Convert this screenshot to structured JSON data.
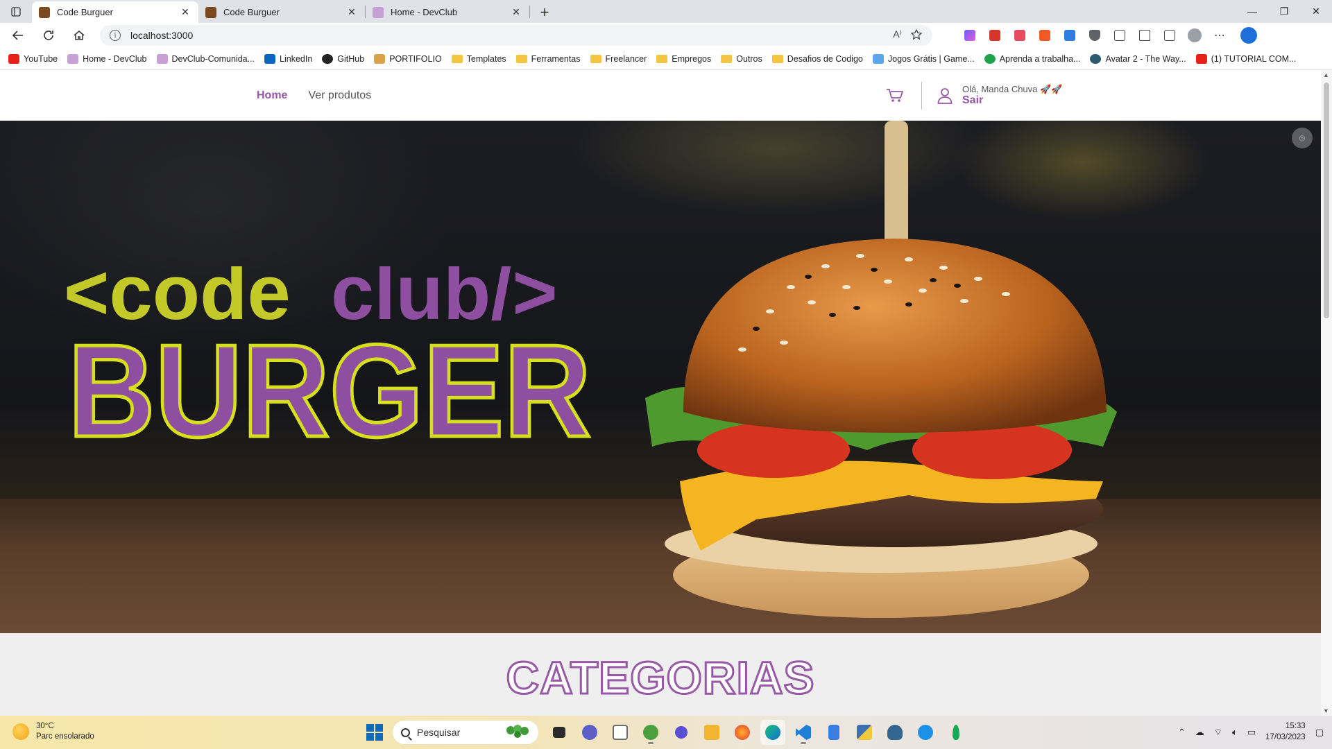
{
  "browser": {
    "tabs": [
      {
        "title": "Code Burguer",
        "active": true,
        "favicon_color": "#7a4a1e"
      },
      {
        "title": "Code Burguer",
        "active": false,
        "favicon_color": "#7a4a1e"
      },
      {
        "title": "Home - DevClub",
        "active": false,
        "favicon_color": "#c7a0d6"
      }
    ],
    "new_tab_icon": "+",
    "window_controls": {
      "minimize": "—",
      "restore": "❐",
      "close": "✕"
    },
    "url": "localhost:3000",
    "read_aloud_icon": "A⁾",
    "bookmarks": [
      {
        "label": "YouTube",
        "icon": "youtube-icon",
        "color": "#e62117"
      },
      {
        "label": "Home - DevClub",
        "icon": "devclub-icon",
        "color": "#c7a0d6"
      },
      {
        "label": "DevClub-Comunida...",
        "icon": "devclub-icon",
        "color": "#c7a0d6"
      },
      {
        "label": "LinkedIn",
        "icon": "linkedin-icon",
        "color": "#0a66c2"
      },
      {
        "label": "GitHub",
        "icon": "github-icon",
        "color": "#222222"
      },
      {
        "label": "PORTIFOLIO",
        "icon": "portfolio-icon",
        "color": "#d9a24b"
      },
      {
        "label": "Templates",
        "icon": "folder-icon",
        "color": "#f4c542"
      },
      {
        "label": "Ferramentas",
        "icon": "folder-icon",
        "color": "#f4c542"
      },
      {
        "label": "Freelancer",
        "icon": "folder-icon",
        "color": "#f4c542"
      },
      {
        "label": "Empregos",
        "icon": "folder-icon",
        "color": "#f4c542"
      },
      {
        "label": "Outros",
        "icon": "folder-icon",
        "color": "#f4c542"
      },
      {
        "label": "Desafios de Codigo",
        "icon": "folder-icon",
        "color": "#f4c542"
      },
      {
        "label": "Jogos Grátis | Game...",
        "icon": "games-icon",
        "color": "#5aa6e8"
      },
      {
        "label": "Aprenda a trabalha...",
        "icon": "hotmart-icon",
        "color": "#1fa34a"
      },
      {
        "label": "Avatar 2 - The Way...",
        "icon": "avatar-icon",
        "color": "#2a5b6e"
      },
      {
        "label": "(1) TUTORIAL COM...",
        "icon": "youtube-icon",
        "color": "#e62117"
      }
    ]
  },
  "site": {
    "nav": {
      "home": "Home",
      "products": "Ver produtos"
    },
    "greeting": "Olá, Manda Chuva 🚀🚀",
    "logout": "Sair",
    "brand_color": "#9758a6",
    "logo": {
      "code": "<code",
      "club": "club/>",
      "burger": "BURGER",
      "lime": "#c4c92a",
      "purple": "#8f4fa0"
    },
    "categories_title": "CATEGORIAS"
  },
  "taskbar": {
    "weather_temp": "30°C",
    "weather_desc": "Parc ensolarado",
    "search_placeholder": "Pesquisar",
    "time": "15:33",
    "date": "17/03/2023",
    "apps": [
      {
        "name": "task-view-icon",
        "color": "#2b2b2b",
        "open": false
      },
      {
        "name": "teams-chat-icon",
        "color": "#5b5fc7",
        "open": false
      },
      {
        "name": "notepad-icon",
        "color": "#6e6e6e",
        "open": false
      },
      {
        "name": "utorrent-icon",
        "color": "#4aa03f",
        "open": true
      },
      {
        "name": "app-moon-icon",
        "color": "#5b4fd6",
        "open": false
      },
      {
        "name": "file-explorer-icon",
        "color": "#f2b632",
        "open": false
      },
      {
        "name": "firefox-icon",
        "color": "#f06a2a",
        "open": false
      },
      {
        "name": "edge-icon",
        "color": "#12a37f",
        "open": true,
        "focus": true
      },
      {
        "name": "vscode-icon",
        "color": "#1f7fd6",
        "open": true
      },
      {
        "name": "notes-icon",
        "color": "#3b7de0",
        "open": false
      },
      {
        "name": "python-icon",
        "color": "#3e6fb0",
        "open": false
      },
      {
        "name": "postgres-icon",
        "color": "#336791",
        "open": false
      },
      {
        "name": "docker-icon",
        "color": "#1d91e6",
        "open": false
      },
      {
        "name": "mongodb-icon",
        "color": "#13aa52",
        "open": false
      }
    ]
  }
}
